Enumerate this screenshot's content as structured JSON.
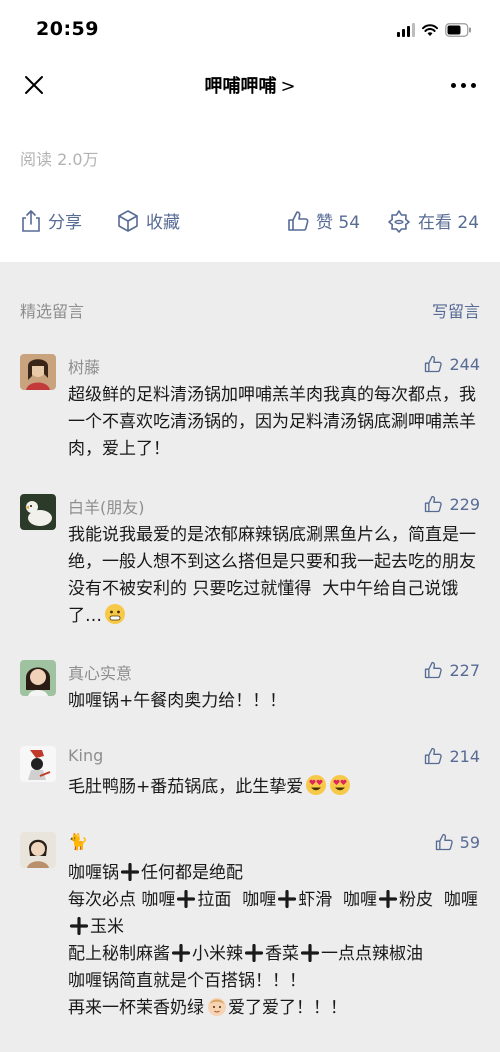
{
  "status_bar": {
    "time": "20:59"
  },
  "nav": {
    "title": "呷哺呷哺",
    "title_arrow": ">"
  },
  "article": {
    "read_count": "阅读 2.0万"
  },
  "actions": {
    "share": "分享",
    "favorite": "收藏",
    "like": "赞 54",
    "watching": "在看 24"
  },
  "comments_section": {
    "title": "精选留言",
    "write": "写留言"
  },
  "comments": [
    {
      "name": "树藤",
      "likes": "244",
      "text": "超级鲜的足料清汤锅加呷哺羔羊肉我真的每次都点，我一个不喜欢吃清汤锅的，因为足料清汤锅底涮呷哺羔羊肉，爱上了！"
    },
    {
      "name": "白羊(朋友)",
      "likes": "229",
      "text": "我能说我最爱的是浓郁麻辣锅底涮黑鱼片么，简直是一绝，一般人想不到这么搭但是只要和我一起去吃的朋友没有不被安利的 只要吃过就懂得  大中午给自己说饿了…"
    },
    {
      "name": "真心实意",
      "likes": "227",
      "text": "咖喱锅+午餐肉奥力给！！！"
    },
    {
      "name": "King",
      "likes": "214",
      "text": "毛肚鸭肠+番茄锅底，此生挚爱"
    },
    {
      "name": "🐈",
      "likes": "59",
      "lines": [
        "咖喱锅",
        "任何都是绝配",
        "每次必点 咖喱",
        "拉面  咖喱",
        "虾滑  咖喱",
        "粉皮  咖喱",
        "玉米",
        "配上秘制麻酱",
        "小米辣",
        "香菜",
        "一点点辣椒油",
        "咖喱锅简直就是个百搭锅！！！",
        "再来一杯茉香奶绿",
        "爱了爱了！！！"
      ]
    }
  ],
  "colors": {
    "link": "#576b95",
    "muted": "#8e8e8e",
    "background": "#ededed",
    "text": "#191919"
  }
}
